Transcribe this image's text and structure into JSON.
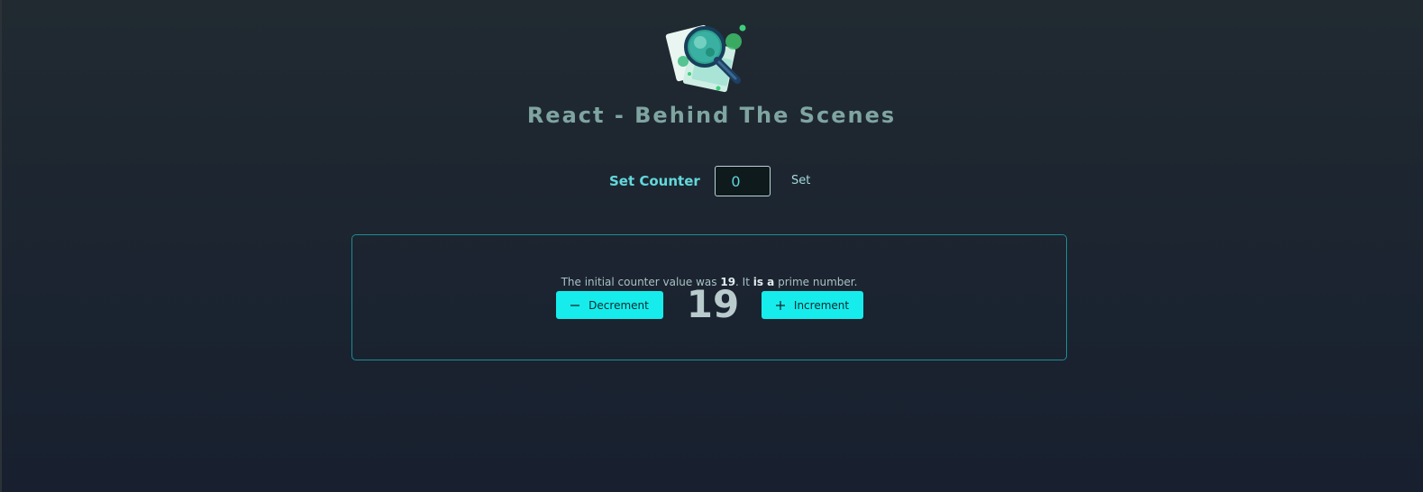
{
  "header": {
    "logo": "magnifying-glass-over-documents-logo",
    "title": "React - Behind The Scenes"
  },
  "configure": {
    "label": "Set Counter",
    "input_value": "0",
    "set_button": "Set"
  },
  "counter": {
    "info_prefix": "The initial counter value was ",
    "initial_value": "19",
    "info_middle": ". It ",
    "prime_text": "is a",
    "info_suffix": " prime number.",
    "current_value": "19",
    "decrement_label": "Decrement",
    "increment_label": "Increment"
  },
  "colors": {
    "accent": "#16ecec",
    "label": "#63d8dc",
    "card_border": "#1d8c93",
    "title": "#7fa4a1"
  },
  "icons": {
    "decrement": "minus-icon",
    "increment": "plus-icon"
  }
}
